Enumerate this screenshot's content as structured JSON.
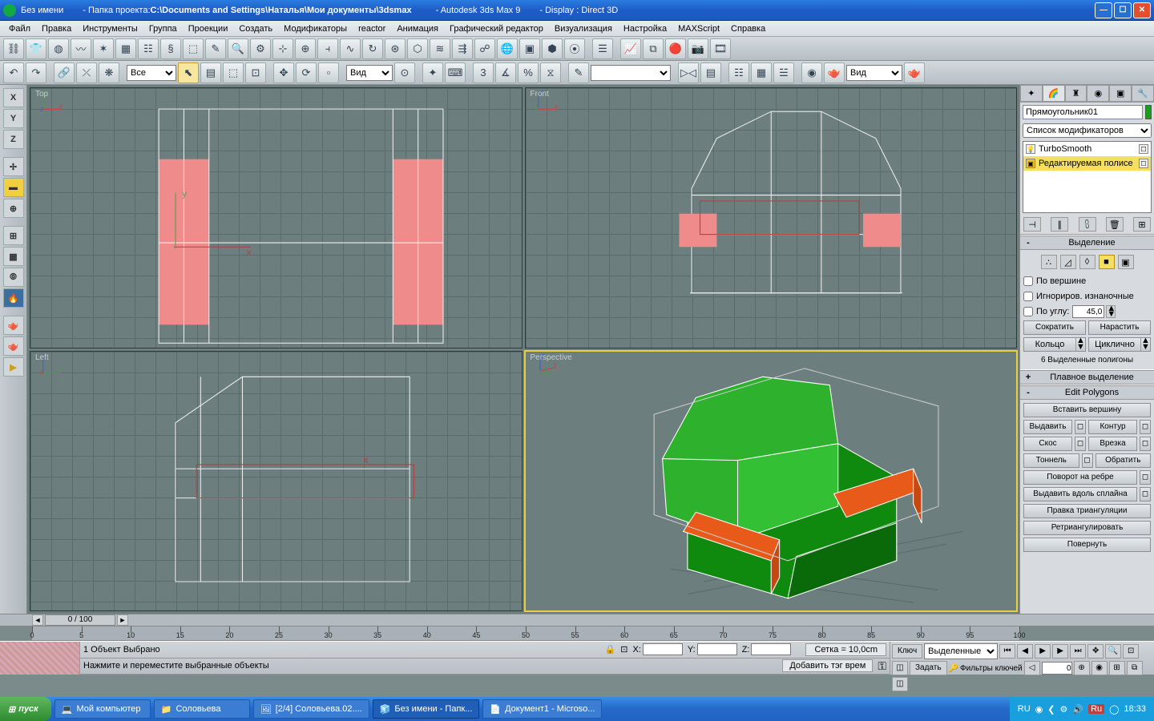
{
  "titlebar": {
    "untitled": "Без имени",
    "project_prefix": "- Папка проекта: ",
    "project_path": "C:\\Documents and Settings\\Наталья\\Мои документы\\3dsmax",
    "app": "- Autodesk 3ds Max 9",
    "display": "- Display : Direct 3D"
  },
  "menu": [
    "Файл",
    "Правка",
    "Инструменты",
    "Группа",
    "Проекции",
    "Создать",
    "Модификаторы",
    "reactor",
    "Анимация",
    "Графический редактор",
    "Визуализация",
    "Настройка",
    "MAXScript",
    "Справка"
  ],
  "toolbar2": {
    "sel_filter": "Все",
    "ref_sys": "Вид",
    "named_sel": "",
    "view_dd": "Вид"
  },
  "viewports": {
    "top": "Top",
    "front": "Front",
    "left": "Left",
    "perspective": "Perspective"
  },
  "cmdpanel": {
    "obj_name": "Прямоугольник01",
    "mod_list_placeholder": "Список модификаторов",
    "stack": {
      "row1": "TurboSmooth",
      "row2": "Редактируемая полисе"
    },
    "roll_selection": "Выделение",
    "by_vertex": "По вершине",
    "ignore_back": "Игнориров. изнаночные",
    "by_angle": "По углу:",
    "angle_val": "45,0",
    "shrink": "Сократить",
    "grow": "Нарастить",
    "ring": "Кольцо",
    "loop": "Циклично",
    "sel_count": "6 Выделенные полигоны",
    "roll_softsel": "Плавное выделение",
    "roll_editpoly": "Edit Polygons",
    "insert_vertex": "Вставить вершину",
    "extrude": "Выдавить",
    "outline": "Контур",
    "bevel": "Скос",
    "inset": "Врезка",
    "bridge": "Тоннель",
    "flip": "Обратить",
    "hinge": "Поворот на ребре",
    "extrude_spline": "Выдавить вдоль сплайна",
    "edit_tri": "Правка триангуляции",
    "retri": "Ретриангулировать",
    "turn": "Повернуть"
  },
  "timeline": {
    "thumb": "0 / 100",
    "ticks": [
      0,
      5,
      10,
      15,
      20,
      25,
      30,
      35,
      40,
      45,
      50,
      55,
      60,
      65,
      70,
      75,
      80,
      85,
      90,
      95,
      100
    ]
  },
  "status": {
    "line1": "1 Объект Выбрано",
    "line2": "Нажмите и переместите выбранные объекты",
    "grid": "Сетка = 10,0cm",
    "addtag": "Добавить тэг врем",
    "key_btn": "Ключ",
    "set_btn": "Задать",
    "sel_dd": "Выделенные",
    "keyfilters": "Фильтры ключей",
    "frame": "0",
    "x_lbl": "X:",
    "y_lbl": "Y:",
    "z_lbl": "Z:"
  },
  "taskbar": {
    "start": "пуск",
    "tasks": [
      {
        "label": "Мой компьютер",
        "icon": "💻"
      },
      {
        "label": "Соловьева",
        "icon": "📁"
      },
      {
        "label": "[2/4] Соловьева.02....",
        "icon": "🖼"
      },
      {
        "label": "Без имени    - Папк...",
        "icon": "🧊",
        "active": true
      },
      {
        "label": "Документ1 - Microso...",
        "icon": "📄"
      }
    ],
    "lang": "RU",
    "lang2": "Ru",
    "clock": "18:33"
  }
}
